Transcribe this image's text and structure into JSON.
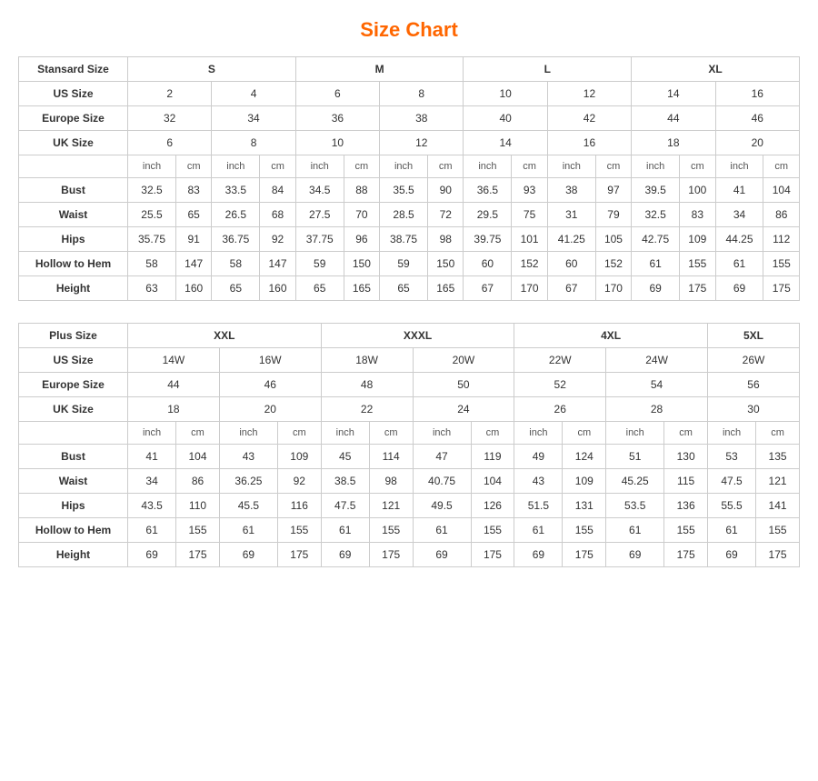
{
  "title": "Size Chart",
  "standard": {
    "headers": {
      "col1": "Stansard Size",
      "s": "S",
      "m": "M",
      "l": "L",
      "xl": "XL"
    },
    "us_size": {
      "label": "US Size",
      "values": [
        "2",
        "4",
        "6",
        "8",
        "10",
        "12",
        "14",
        "16"
      ]
    },
    "europe_size": {
      "label": "Europe Size",
      "values": [
        "32",
        "34",
        "36",
        "38",
        "40",
        "42",
        "44",
        "46"
      ]
    },
    "uk_size": {
      "label": "UK Size",
      "values": [
        "6",
        "8",
        "10",
        "12",
        "14",
        "16",
        "18",
        "20"
      ]
    },
    "units": [
      "inch",
      "cm",
      "inch",
      "cm",
      "inch",
      "cm",
      "inch",
      "cm",
      "inch",
      "cm",
      "inch",
      "cm",
      "inch",
      "cm",
      "inch",
      "cm"
    ],
    "bust": {
      "label": "Bust",
      "values": [
        "32.5",
        "83",
        "33.5",
        "84",
        "34.5",
        "88",
        "35.5",
        "90",
        "36.5",
        "93",
        "38",
        "97",
        "39.5",
        "100",
        "41",
        "104"
      ]
    },
    "waist": {
      "label": "Waist",
      "values": [
        "25.5",
        "65",
        "26.5",
        "68",
        "27.5",
        "70",
        "28.5",
        "72",
        "29.5",
        "75",
        "31",
        "79",
        "32.5",
        "83",
        "34",
        "86"
      ]
    },
    "hips": {
      "label": "Hips",
      "values": [
        "35.75",
        "91",
        "36.75",
        "92",
        "37.75",
        "96",
        "38.75",
        "98",
        "39.75",
        "101",
        "41.25",
        "105",
        "42.75",
        "109",
        "44.25",
        "112"
      ]
    },
    "hollow_to_hem": {
      "label": "Hollow to Hem",
      "values": [
        "58",
        "147",
        "58",
        "147",
        "59",
        "150",
        "59",
        "150",
        "60",
        "152",
        "60",
        "152",
        "61",
        "155",
        "61",
        "155"
      ]
    },
    "height": {
      "label": "Height",
      "values": [
        "63",
        "160",
        "65",
        "160",
        "65",
        "165",
        "65",
        "165",
        "67",
        "170",
        "67",
        "170",
        "69",
        "175",
        "69",
        "175"
      ]
    }
  },
  "plus": {
    "headers": {
      "col1": "Plus Size",
      "xxl": "XXL",
      "xxxl": "XXXL",
      "4xl": "4XL",
      "5xl": "5XL"
    },
    "us_size": {
      "label": "US Size",
      "values": [
        "14W",
        "16W",
        "18W",
        "20W",
        "22W",
        "24W",
        "26W"
      ]
    },
    "europe_size": {
      "label": "Europe Size",
      "values": [
        "44",
        "46",
        "48",
        "50",
        "52",
        "54",
        "56"
      ]
    },
    "uk_size": {
      "label": "UK Size",
      "values": [
        "18",
        "20",
        "22",
        "24",
        "26",
        "28",
        "30"
      ]
    },
    "units": [
      "inch",
      "cm",
      "inch",
      "cm",
      "inch",
      "cm",
      "inch",
      "cm",
      "inch",
      "cm",
      "inch",
      "cm",
      "inch",
      "cm"
    ],
    "bust": {
      "label": "Bust",
      "values": [
        "41",
        "104",
        "43",
        "109",
        "45",
        "114",
        "47",
        "119",
        "49",
        "124",
        "51",
        "130",
        "53",
        "135"
      ]
    },
    "waist": {
      "label": "Waist",
      "values": [
        "34",
        "86",
        "36.25",
        "92",
        "38.5",
        "98",
        "40.75",
        "104",
        "43",
        "109",
        "45.25",
        "115",
        "47.5",
        "121"
      ]
    },
    "hips": {
      "label": "Hips",
      "values": [
        "43.5",
        "110",
        "45.5",
        "116",
        "47.5",
        "121",
        "49.5",
        "126",
        "51.5",
        "131",
        "53.5",
        "136",
        "55.5",
        "141"
      ]
    },
    "hollow_to_hem": {
      "label": "Hollow to Hem",
      "values": [
        "61",
        "155",
        "61",
        "155",
        "61",
        "155",
        "61",
        "155",
        "61",
        "155",
        "61",
        "155",
        "61",
        "155"
      ]
    },
    "height": {
      "label": "Height",
      "values": [
        "69",
        "175",
        "69",
        "175",
        "69",
        "175",
        "69",
        "175",
        "69",
        "175",
        "69",
        "175",
        "69",
        "175"
      ]
    }
  }
}
